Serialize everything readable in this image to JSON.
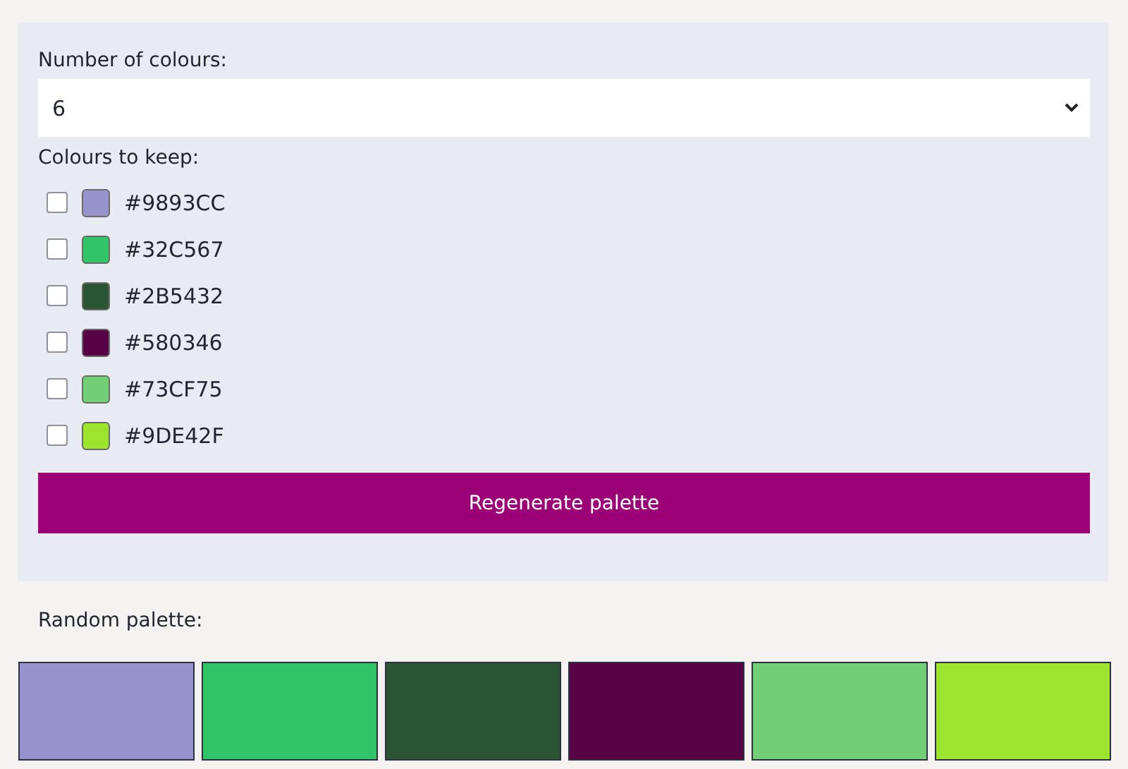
{
  "count_field": {
    "label": "Number of colours:",
    "value": "6"
  },
  "keep_section": {
    "label": "Colours to keep:",
    "colours": [
      {
        "hex": "#9893CC",
        "color": "#9893cc",
        "checked": false
      },
      {
        "hex": "#32C567",
        "color": "#32c567",
        "checked": false
      },
      {
        "hex": "#2B5432",
        "color": "#2b5432",
        "checked": false
      },
      {
        "hex": "#580346",
        "color": "#580346",
        "checked": false
      },
      {
        "hex": "#73CF75",
        "color": "#73cf75",
        "checked": false
      },
      {
        "hex": "#9DE42F",
        "color": "#9de42f",
        "checked": false
      }
    ]
  },
  "regenerate_button": {
    "label": "Regenerate palette"
  },
  "palette": {
    "label": "Random palette:",
    "swatches": [
      {
        "color": "#9893cc"
      },
      {
        "color": "#32c567"
      },
      {
        "color": "#2b5432"
      },
      {
        "color": "#580346"
      },
      {
        "color": "#73cf75"
      },
      {
        "color": "#9de42f"
      }
    ]
  }
}
